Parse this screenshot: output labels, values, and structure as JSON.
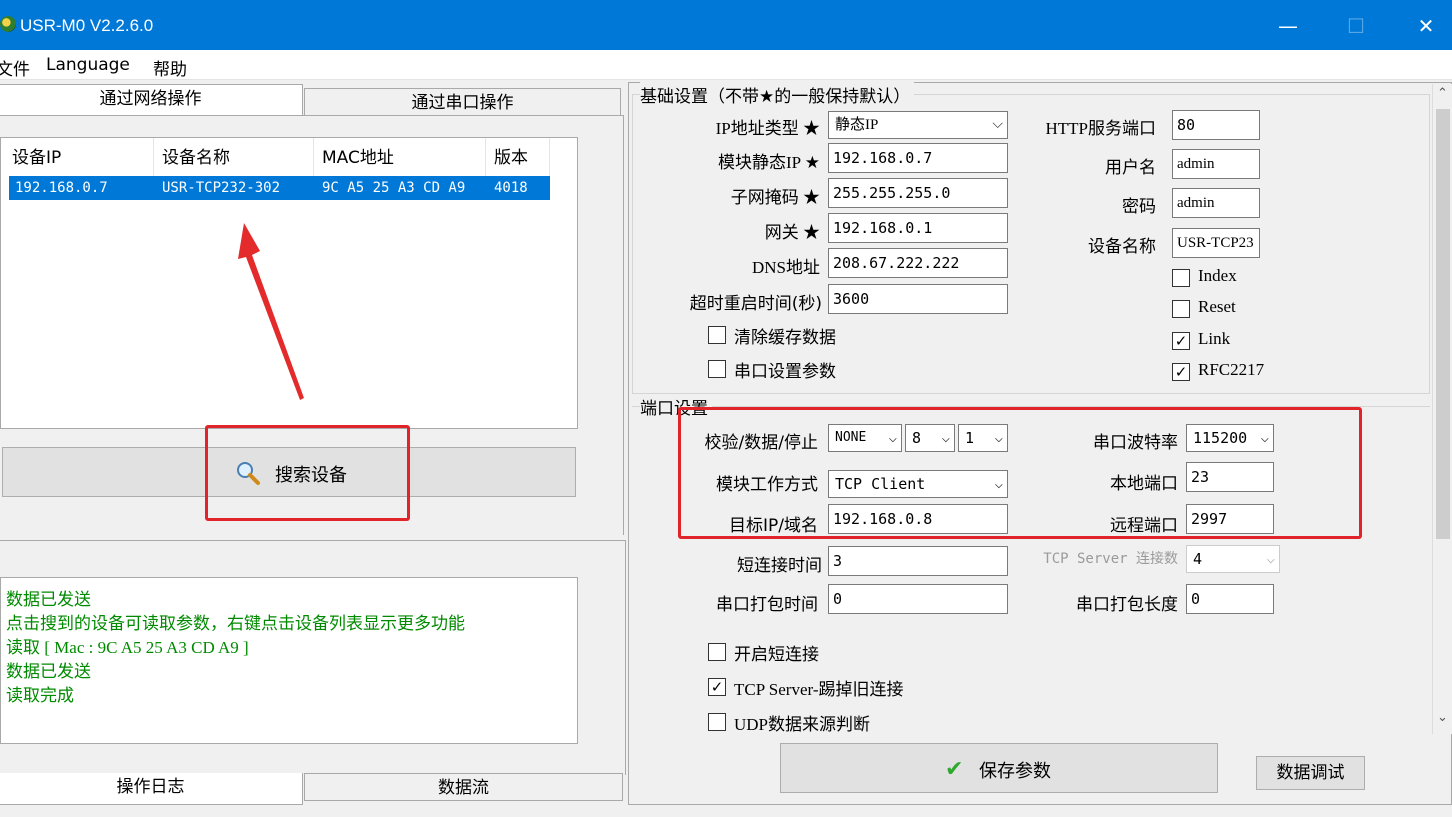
{
  "window": {
    "title": "USR-M0 V2.2.6.0",
    "minimize": "—",
    "maximize": "☐",
    "close": "✕"
  },
  "menu": [
    "文件",
    "Language",
    "帮助"
  ],
  "left": {
    "tabs": [
      "通过网络操作",
      "通过串口操作"
    ],
    "device_list": {
      "columns": [
        "设备IP",
        "设备名称",
        "MAC地址",
        "版本"
      ],
      "rows": [
        [
          "192.168.0.7",
          "USR-TCP232-302",
          "9C A5 25 A3 CD A9",
          "4018"
        ]
      ]
    },
    "search_button": "搜索设备",
    "log_lines": [
      "数据已发送",
      "点击搜到的设备可读取参数，右键点击设备列表显示更多功能",
      "读取 [ Mac : 9C A5 25 A3 CD A9 ]",
      "数据已发送",
      "读取完成"
    ],
    "bottom_tabs": [
      "操作日志",
      "数据流"
    ]
  },
  "basic": {
    "group_title": "基础设置（不带★的一般保持默认）",
    "ip_type_label": "IP地址类型 ★",
    "ip_type_value": "静态IP",
    "static_ip_label": "模块静态IP ★",
    "static_ip_value": "192.168.0.7",
    "subnet_label": "子网掩码 ★",
    "subnet_value": "255.255.255.0",
    "gateway_label": "网关 ★",
    "gateway_value": "192.168.0.1",
    "dns_label": "DNS地址",
    "dns_value": "208.67.222.222",
    "timeout_label": "超时重启时间(秒)",
    "timeout_value": "3600",
    "clear_cache_label": "清除缓存数据",
    "serial_params_label": "串口设置参数",
    "http_port_label": "HTTP服务端口",
    "http_port_value": "80",
    "username_label": "用户名",
    "username_value": "admin",
    "password_label": "密码",
    "password_value": "admin",
    "device_name_label": "设备名称",
    "device_name_value": "USR-TCP23",
    "index_label": "Index",
    "reset_label": "Reset",
    "link_label": "Link",
    "rfc_label": "RFC2217"
  },
  "checks": {
    "clear_cache": false,
    "serial_params": false,
    "index": false,
    "reset": false,
    "link": true,
    "rfc2217": true,
    "short_conn": false,
    "kick_old": true,
    "udp_source": false
  },
  "port": {
    "group_title": "端口设置",
    "parity_label": "校验/数据/停止",
    "parity_value": "NONE",
    "data_bits_value": "8",
    "stop_bits_value": "1",
    "work_mode_label": "模块工作方式",
    "work_mode_value": "TCP Client",
    "target_label": "目标IP/域名",
    "target_value": "192.168.0.8",
    "short_time_label": "短连接时间",
    "short_time_value": "3",
    "pack_time_label": "串口打包时间",
    "pack_time_value": "0",
    "baud_label": "串口波特率",
    "baud_value": "115200",
    "local_port_label": "本地端口",
    "local_port_value": "23",
    "remote_port_label": "远程端口",
    "remote_port_value": "2997",
    "server_conn_label": "TCP Server 连接数",
    "server_conn_value": "4",
    "pack_len_label": "串口打包长度",
    "pack_len_value": "0",
    "short_conn_label": "开启短连接",
    "kick_old_label": "TCP Server-踢掉旧连接",
    "udp_source_label": "UDP数据来源判断"
  },
  "actions": {
    "save": "保存参数",
    "debug": "数据调试"
  }
}
